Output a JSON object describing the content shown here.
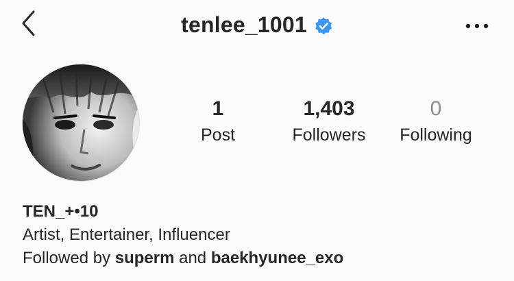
{
  "header": {
    "username": "tenlee_1001",
    "back_icon": "chevron-left-icon",
    "verified_icon": "verified-badge-icon",
    "more_icon": "more-horizontal-icon",
    "verified_color": "#3897f0"
  },
  "profile": {
    "avatar": "profile-photo-grayscale"
  },
  "stats": {
    "posts": {
      "value": "1",
      "label": "Post"
    },
    "followers": {
      "value": "1,403",
      "label": "Followers"
    },
    "following": {
      "value": "0",
      "label": "Following"
    }
  },
  "bio": {
    "name": "TEN_+•10",
    "category": "Artist, Entertainer, Influencer",
    "followed_by_prefix": "Followed by",
    "followed_by_user_1": "superm",
    "followed_by_joiner": "and",
    "followed_by_user_2": "baekhyunee_exo"
  }
}
